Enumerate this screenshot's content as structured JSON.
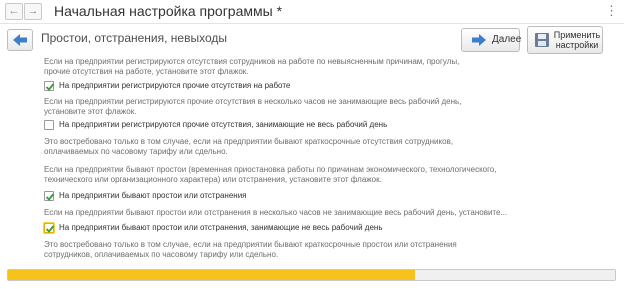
{
  "window": {
    "title": "Начальная настройка программы *",
    "nav_back_glyph": "←",
    "nav_forward_glyph": "→",
    "more_glyph": "⋮"
  },
  "header": {
    "section_title": "Простои, отстранения, невыходы",
    "next_label": "Далее",
    "apply_label": "Применить настройки"
  },
  "content": {
    "items": [
      {
        "description": "Если на предприятии регистрируются отсутствия сотрудников на работе по невыясненным причинам, прогулы, прочие отсутствия на работе, установите этот флажок.",
        "checkbox_label": "На предприятии регистрируются прочие отсутствия на работе",
        "checked": true
      },
      {
        "description": "Если на предприятии регистрируются прочие отсутствия в несколько часов не занимающие весь рабочий день, установите этот флажок.",
        "checkbox_label": "На предприятии регистрируются прочие отсутствия, занимающие не весь рабочий день",
        "checked": false,
        "note": "Это востребовано только в том случае, если на предприятии бывают краткосрочные отсутствия сотрудников, оплачиваемых по часовому тарифу или сдельно."
      },
      {
        "description": "Если на предприятии бывают простои (временная приостановка работы по причинам экономического, технологического, технического или организационного характера) или отстранения, установите этот флажок.",
        "checkbox_label": "На предприятии бывают простои или отстранения",
        "checked": true
      },
      {
        "description": "Если на предприятии бывают простои или отстранения в несколько часов не занимающие весь рабочий день, установите...",
        "checkbox_label": "На предприятии бывают простои или отстранения, занимающие не весь рабочий день",
        "checked": true,
        "focused": true,
        "note": "Это востребовано только в том случае, если на предприятии бывают краткосрочные простои или отстранения сотрудников, оплачиваемых по часовому тарифу или сдельно."
      }
    ]
  },
  "progress": {
    "fraction": 0.67,
    "fill_color": "#f5c31c"
  },
  "colors": {
    "accent_arrow": "#3f7fc9",
    "checkmark": "#3a9a3a",
    "focus": "#f5d23a"
  },
  "icons": {
    "back": "arrow-left-icon",
    "next": "arrow-right-icon",
    "apply": "floppy-disk-icon"
  }
}
